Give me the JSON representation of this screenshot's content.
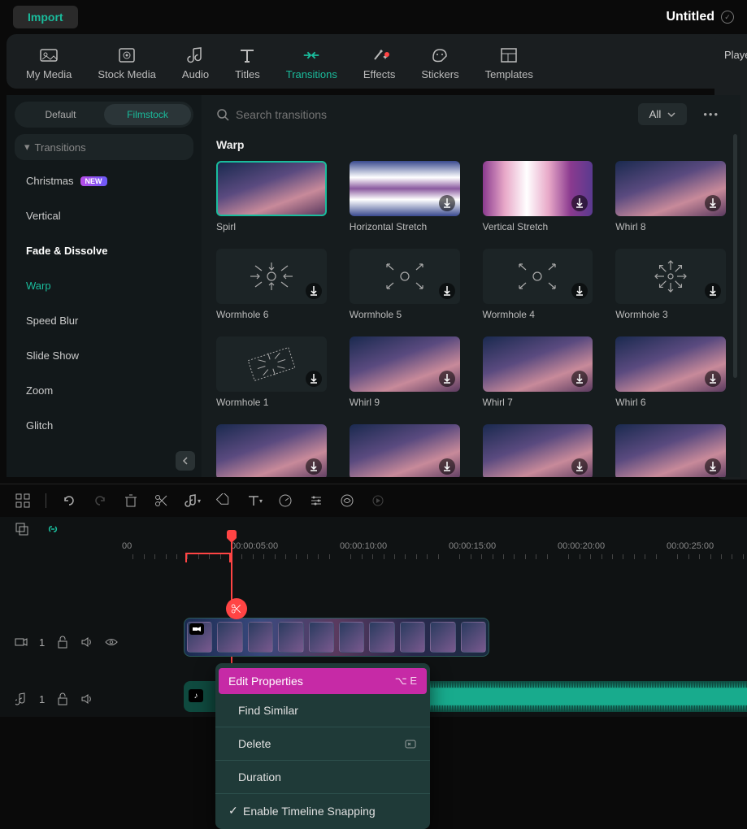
{
  "topbar": {
    "import_label": "Import",
    "project_title": "Untitled"
  },
  "main_tabs": [
    {
      "id": "my-media",
      "label": "My Media"
    },
    {
      "id": "stock-media",
      "label": "Stock Media"
    },
    {
      "id": "audio",
      "label": "Audio"
    },
    {
      "id": "titles",
      "label": "Titles"
    },
    {
      "id": "transitions",
      "label": "Transitions",
      "active": true
    },
    {
      "id": "effects",
      "label": "Effects",
      "badge": true
    },
    {
      "id": "stickers",
      "label": "Stickers"
    },
    {
      "id": "templates",
      "label": "Templates"
    }
  ],
  "player_label": "Playe",
  "sidebar": {
    "tabs": {
      "default": "Default",
      "filmstock": "Filmstock"
    },
    "head": "Transitions",
    "items": [
      {
        "label": "Christmas",
        "new": true
      },
      {
        "label": "Vertical"
      },
      {
        "label": "Fade & Dissolve",
        "bold": true
      },
      {
        "label": "Warp",
        "active": true
      },
      {
        "label": "Speed Blur"
      },
      {
        "label": "Slide Show"
      },
      {
        "label": "Zoom"
      },
      {
        "label": "Glitch"
      }
    ]
  },
  "content": {
    "search_placeholder": "Search transitions",
    "filter_label": "All",
    "section_title": "Warp",
    "items": [
      {
        "label": "Spirl",
        "selected": true,
        "kind": "sunset"
      },
      {
        "label": "Horizontal Stretch",
        "dl": true,
        "kind": "stripes"
      },
      {
        "label": "Vertical Stretch",
        "dl": true,
        "kind": "vstripes"
      },
      {
        "label": "Whirl 8",
        "dl": true,
        "kind": "sunset"
      },
      {
        "label": "Wormhole 6",
        "dl": true,
        "kind": "dark-in"
      },
      {
        "label": "Wormhole 5",
        "dl": true,
        "kind": "dark-out"
      },
      {
        "label": "Wormhole 4",
        "dl": true,
        "kind": "dark-out"
      },
      {
        "label": "Wormhole 3",
        "dl": true,
        "kind": "dark-star"
      },
      {
        "label": "Wormhole 1",
        "dl": true,
        "kind": "dark-in-tilt"
      },
      {
        "label": "Whirl 9",
        "dl": true,
        "kind": "sunset"
      },
      {
        "label": "Whirl 7",
        "dl": true,
        "kind": "sunset"
      },
      {
        "label": "Whirl 6",
        "dl": true,
        "kind": "sunset"
      },
      {
        "label": "",
        "dl": true,
        "kind": "sunset"
      },
      {
        "label": "",
        "dl": true,
        "kind": "sunset"
      },
      {
        "label": "",
        "dl": true,
        "kind": "sunset"
      },
      {
        "label": "",
        "dl": true,
        "kind": "sunset"
      }
    ]
  },
  "timeline": {
    "marks": [
      "00",
      "00:00:05:00",
      "00:00:10:00",
      "00:00:15:00",
      "00:00:20:00",
      "00:00:25:00"
    ],
    "track_video_no": "1",
    "track_audio_no": "1"
  },
  "context_menu": {
    "items": [
      {
        "label": "Edit Properties",
        "shortcut": "⌥ E",
        "highlighted": true
      },
      {
        "label": "Find Similar"
      },
      {
        "sep": true
      },
      {
        "label": "Delete",
        "icon": "del"
      },
      {
        "sep": true
      },
      {
        "label": "Duration"
      },
      {
        "sep": true
      },
      {
        "label": "Enable Timeline Snapping",
        "checked": true
      }
    ]
  }
}
